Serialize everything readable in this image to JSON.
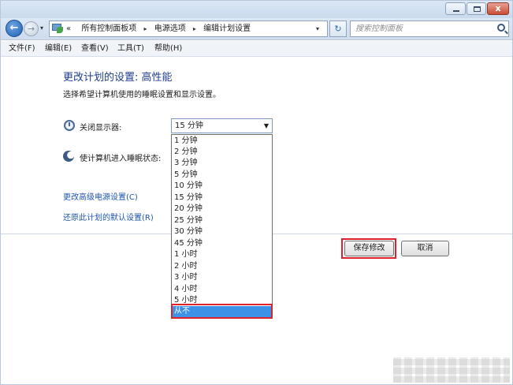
{
  "window": {
    "controls": {
      "close": "x"
    }
  },
  "nav": {
    "back": "←",
    "forward": "→",
    "dropdown": "▾",
    "breadcrumbs": {
      "root": "«",
      "items": [
        "所有控制面板项",
        "电源选项",
        "编辑计划设置"
      ],
      "separator": "▸"
    },
    "refresh": "↻",
    "search_placeholder": "搜索控制面板"
  },
  "menu": {
    "items": [
      "文件(F)",
      "编辑(E)",
      "查看(V)",
      "工具(T)",
      "帮助(H)"
    ]
  },
  "content": {
    "heading": "更改计划的设置: 高性能",
    "subtext": "选择希望计算机使用的睡眠设置和显示设置。",
    "display_off_label": "关闭显示器:",
    "sleep_label": "使计算机进入睡眠状态:",
    "display_off_value": "15 分钟",
    "links": {
      "advanced": "更改高级电源设置(C)",
      "restore": "还原此计划的默认设置(R)"
    }
  },
  "dropdown": {
    "arrow": "▼",
    "options": [
      "1 分钟",
      "2 分钟",
      "3 分钟",
      "5 分钟",
      "10 分钟",
      "15 分钟",
      "20 分钟",
      "25 分钟",
      "30 分钟",
      "45 分钟",
      "1 小时",
      "2 小时",
      "3 小时",
      "4 小时",
      "5 小时",
      "从不"
    ],
    "selected_index": 15
  },
  "buttons": {
    "save": "保存修改",
    "cancel": "取消"
  },
  "colors": {
    "highlight": "#e0202a",
    "selection": "#3b92e6",
    "heading": "#1f3d8c",
    "link": "#1f56b0"
  }
}
